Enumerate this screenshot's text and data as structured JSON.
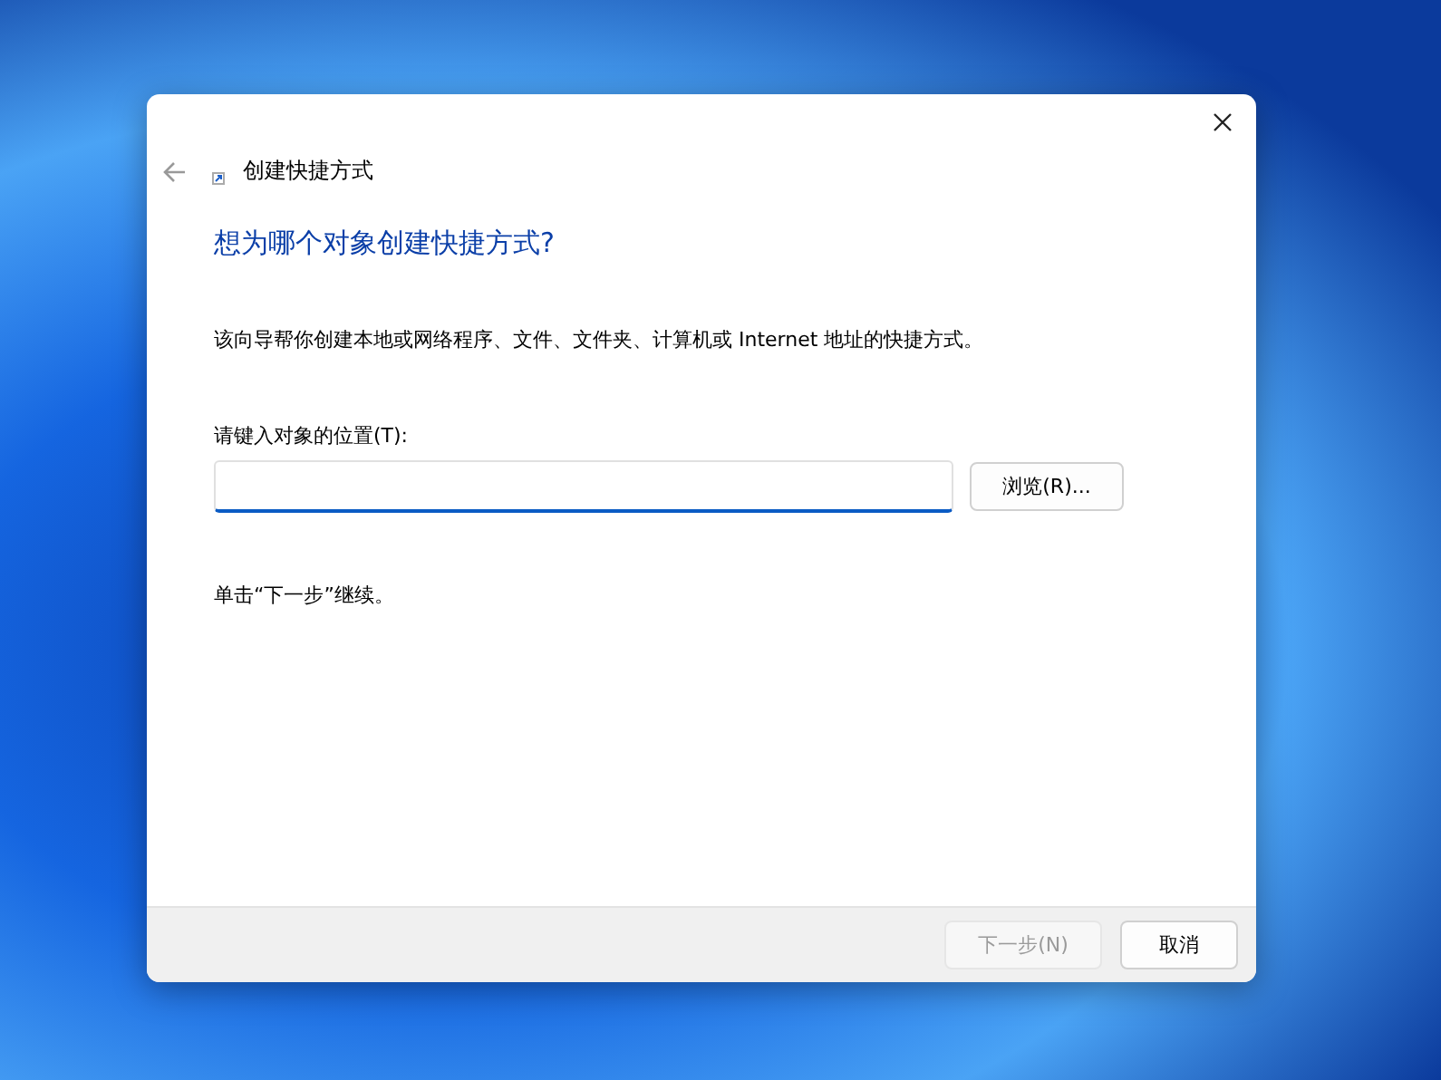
{
  "window": {
    "title": "创建快捷方式"
  },
  "heading": "想为哪个对象创建快捷方式?",
  "description": "该向导帮你创建本地或网络程序、文件、文件夹、计算机或 Internet 地址的快捷方式。",
  "location": {
    "label": "请键入对象的位置(T):",
    "focused": true,
    "browse_button": "浏览(R)..."
  },
  "hint": "单击“下一步”继续。",
  "buttons": [
    {
      "label": "下一步(N)",
      "disabled": true
    },
    {
      "label": "取消",
      "disabled": false
    }
  ]
}
